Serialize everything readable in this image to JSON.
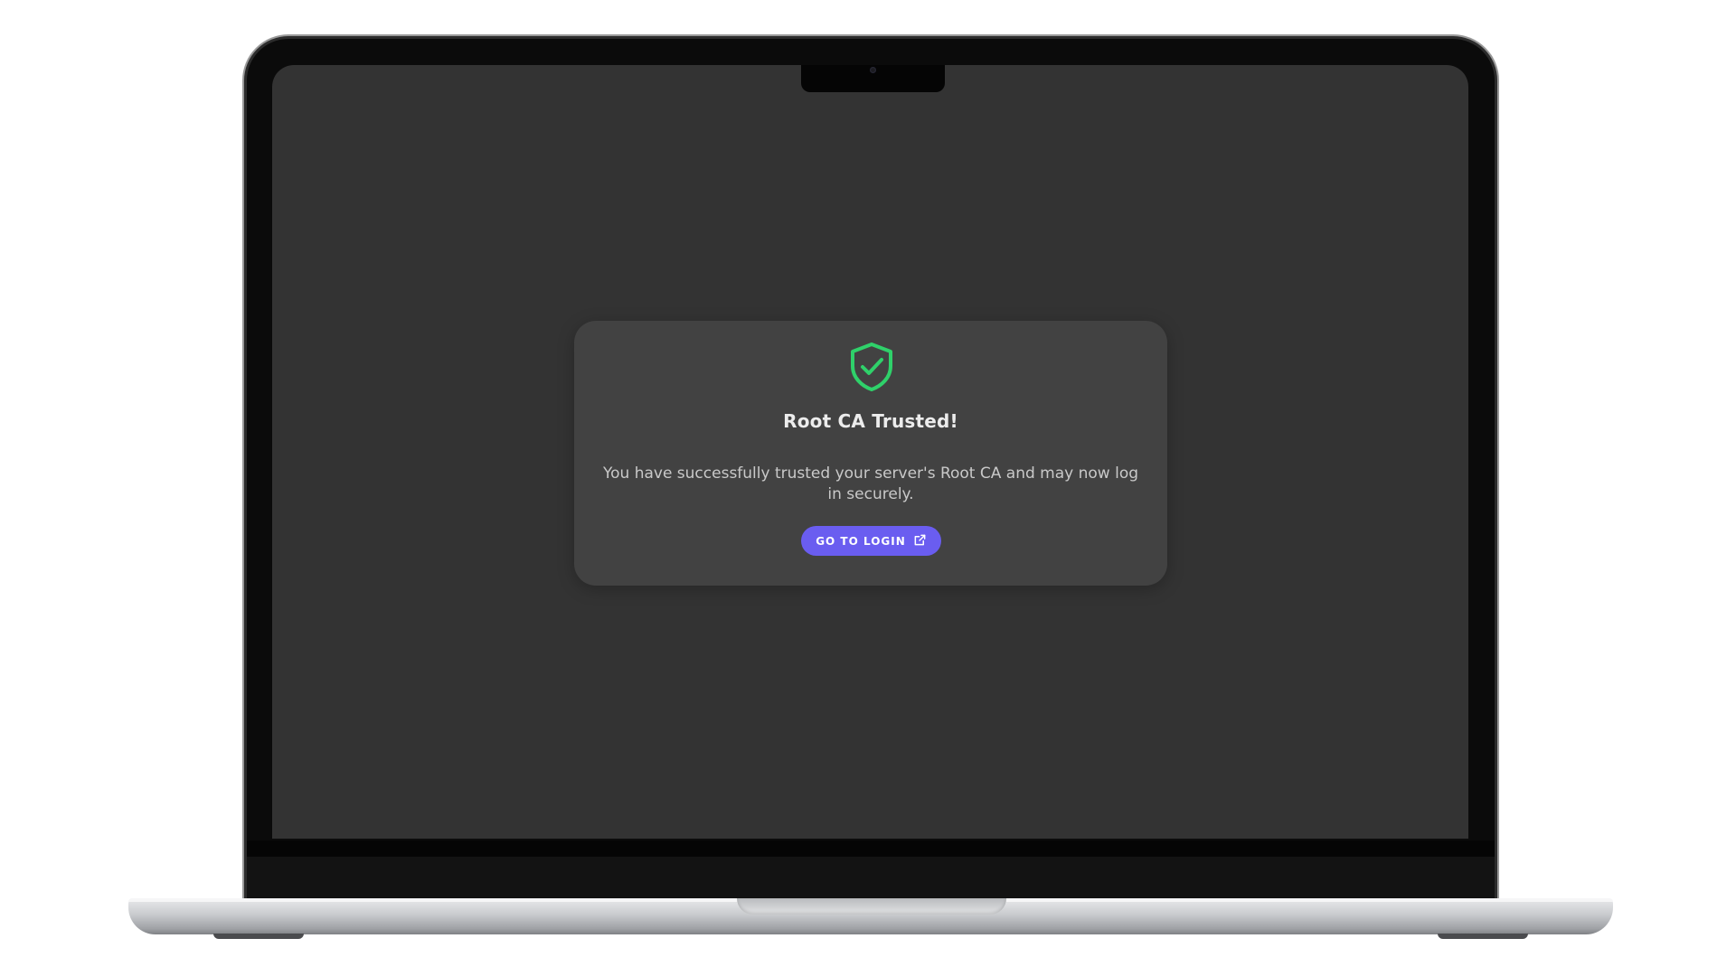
{
  "dialog": {
    "icon": "shield-check-icon",
    "title": "Root CA Trusted!",
    "message": "You have successfully trusted your server's Root CA and may now log in securely.",
    "button_label": "GO TO LOGIN",
    "button_icon": "external-link-icon"
  },
  "colors": {
    "screen_bg": "#333333",
    "card_bg": "#424242",
    "accent_green": "#2fd16a",
    "button_bg": "#6a5df0",
    "title_text": "#ececec",
    "body_text": "#c9c9c9"
  }
}
